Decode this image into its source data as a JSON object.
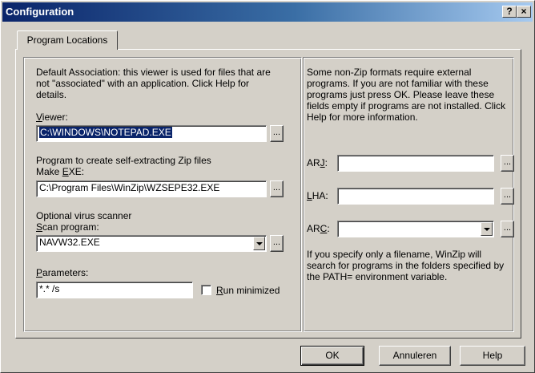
{
  "window": {
    "title": "Configuration"
  },
  "titlebar_buttons": {
    "help": "?",
    "close": "×"
  },
  "tab": {
    "label": "Program Locations"
  },
  "left": {
    "intro": "Default Association: this viewer is used for files that are not \"associated\" with an application.  Click Help for details.",
    "viewer_label": "Viewer:",
    "viewer_value": "C:\\WINDOWS\\NOTEPAD.EXE",
    "sfx_intro": "Program to create self-extracting Zip files",
    "make_exe_label": "Make EXE:",
    "make_exe_value": "C:\\Program Files\\WinZip\\WZSEPE32.EXE",
    "virus_intro": "Optional virus scanner",
    "scan_label": "Scan program:",
    "scan_value": "NAVW32.EXE",
    "params_label": "Parameters:",
    "params_value": "*.* /s",
    "run_minimized_label": "Run minimized",
    "run_minimized_checked": false
  },
  "right": {
    "intro": "Some non-Zip formats require external programs.  If you are not familiar with these programs just press OK.  Please leave these fields empty if programs are not installed.  Click Help for more information.",
    "arj_label": "ARJ:",
    "arj_value": "",
    "lha_label": "LHA:",
    "lha_value": "",
    "arc_label": "ARC:",
    "arc_value": "",
    "footer": "If you specify only a filename, WinZip will search for programs in the folders specified by the PATH= environment variable."
  },
  "browse_label": "...",
  "buttons": {
    "ok": "OK",
    "cancel": "Annuleren",
    "help": "Help"
  },
  "colors": {
    "title_start": "#0a246a",
    "title_end": "#a6caf0",
    "face": "#d4d0c8",
    "selection": "#0a246a"
  }
}
